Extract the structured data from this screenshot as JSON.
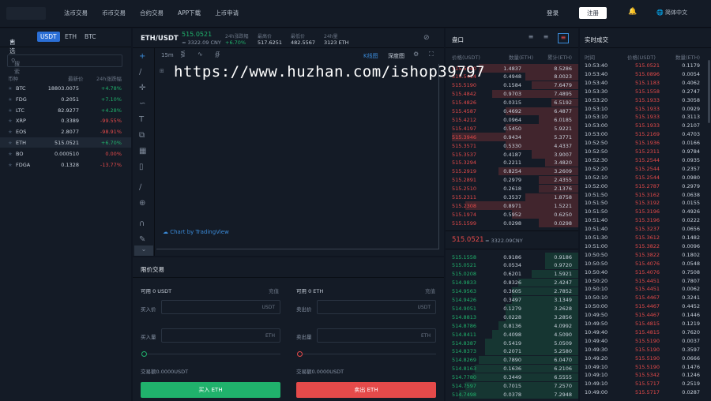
{
  "nav": {
    "items": [
      "法币交易",
      "币币交易",
      "合约交易",
      "APP下载",
      "上币申请"
    ],
    "login": "登录",
    "register": "注册",
    "language": "简体中文"
  },
  "markets": {
    "tabs": [
      "自选",
      "USDT",
      "ETH",
      "BTC"
    ],
    "search_placeholder": "搜索",
    "headers": [
      "币种",
      "最新价",
      "24h涨跌幅"
    ],
    "rows": [
      {
        "name": "BTC",
        "price": "18803.0075",
        "change": "+4.78%",
        "dir": "up"
      },
      {
        "name": "FDG",
        "price": "0.2051",
        "change": "+7.10%",
        "dir": "up"
      },
      {
        "name": "LTC",
        "price": "82.9277",
        "change": "+4.28%",
        "dir": "up"
      },
      {
        "name": "XRP",
        "price": "0.3389",
        "change": "-99.55%",
        "dir": "down"
      },
      {
        "name": "EOS",
        "price": "2.8077",
        "change": "-98.91%",
        "dir": "down"
      },
      {
        "name": "ETH",
        "price": "515.0521",
        "change": "+6.70%",
        "dir": "up",
        "selected": true
      },
      {
        "name": "BO",
        "price": "0.000510",
        "change": "0.00%",
        "dir": "down"
      },
      {
        "name": "FDGA",
        "price": "0.1328",
        "change": "-13.77%",
        "dir": "down"
      }
    ]
  },
  "ticker": {
    "pair": "ETH/USDT",
    "price": "515.0521",
    "cny": "≈ 3322.09 CNY",
    "change_label": "24h涨跌幅",
    "change": "+6.70%",
    "high_label": "最高价",
    "high": "517.6251",
    "low_label": "最低价",
    "low": "482.5567",
    "vol_label": "24h量",
    "vol": "3123 ETH"
  },
  "chart": {
    "interval": "15m",
    "kline": "K线图",
    "depth": "深度图",
    "brand": "Chart by TradingView"
  },
  "trade": {
    "title": "限价交易",
    "buy": {
      "avail": "可用 0 USDT",
      "recharge": "充值",
      "price_label": "买入价",
      "price_unit": "USDT",
      "amount_label": "买入量",
      "amount_unit": "ETH",
      "total": "交易额0.0000USDT",
      "button": "买入 ETH"
    },
    "sell": {
      "avail": "可用 0 ETH",
      "recharge": "充值",
      "price_label": "卖出价",
      "price_unit": "USDT",
      "amount_label": "卖出量",
      "amount_unit": "ETH",
      "total": "交易额0.0000USDT",
      "button": "卖出 ETH"
    }
  },
  "orderbook": {
    "title": "盘口",
    "headers": [
      "价格(USDT)",
      "数量(ETH)",
      "累计(ETH)"
    ],
    "asks": [
      [
        "515.5940",
        "1.4837",
        "8.5286",
        0.75
      ],
      [
        "515.5414",
        "0.4948",
        "8.0023",
        0.4
      ],
      [
        "515.5190",
        "0.1584",
        "7.6479",
        0.35
      ],
      [
        "515.4842",
        "0.9703",
        "7.4895",
        0.65
      ],
      [
        "515.4826",
        "0.0315",
        "6.5192",
        0.2
      ],
      [
        "515.4587",
        "0.4692",
        "6.4877",
        0.55
      ],
      [
        "515.4212",
        "0.0964",
        "6.0185",
        0.3
      ],
      [
        "515.4197",
        "0.5450",
        "5.9221",
        0.55
      ],
      [
        "515.3946",
        "0.9434",
        "5.3771",
        0.95
      ],
      [
        "515.3571",
        "0.5330",
        "4.4337",
        0.55
      ],
      [
        "515.3537",
        "0.4187",
        "3.9007",
        0.35
      ],
      [
        "515.3294",
        "0.2211",
        "3.4820",
        0.25
      ],
      [
        "515.2919",
        "0.8254",
        "3.2609",
        0.6
      ],
      [
        "515.2891",
        "0.2979",
        "2.4355",
        0.3
      ],
      [
        "515.2510",
        "0.2618",
        "2.1376",
        0.3
      ],
      [
        "515.2311",
        "0.3537",
        "1.8758",
        0.4
      ],
      [
        "515.2308",
        "0.8971",
        "1.5221",
        0.85
      ],
      [
        "515.1974",
        "0.5952",
        "0.6250",
        0.5
      ],
      [
        "515.1599",
        "0.0298",
        "0.0298",
        0.3
      ]
    ],
    "last": "515.0521",
    "last_cny": "≈ 3322.09CNY",
    "bids": [
      [
        "515.1558",
        "0.9186",
        "0.9186",
        0.25
      ],
      [
        "515.0521",
        "0.0534",
        "0.9720",
        0.25
      ],
      [
        "515.0208",
        "0.6201",
        "1.5921",
        0.35
      ],
      [
        "514.9833",
        "0.8326",
        "2.4247",
        0.45
      ],
      [
        "514.9563",
        "0.3605",
        "2.7852",
        0.5
      ],
      [
        "514.9426",
        "0.3497",
        "3.1349",
        0.5
      ],
      [
        "514.9051",
        "0.1279",
        "3.2628",
        0.55
      ],
      [
        "514.8813",
        "0.0228",
        "3.2856",
        0.55
      ],
      [
        "514.8786",
        "0.8136",
        "4.0992",
        0.6
      ],
      [
        "514.8411",
        "0.4098",
        "4.5090",
        0.65
      ],
      [
        "514.8387",
        "0.5419",
        "5.0509",
        0.7
      ],
      [
        "514.8373",
        "0.2071",
        "5.2580",
        0.7
      ],
      [
        "514.8269",
        "0.7890",
        "6.0470",
        0.75
      ],
      [
        "514.8163",
        "0.1636",
        "6.2106",
        0.78
      ],
      [
        "514.7780",
        "0.3449",
        "6.5555",
        0.8
      ],
      [
        "514.7597",
        "0.7015",
        "7.2570",
        0.85
      ],
      [
        "514.7498",
        "0.0378",
        "7.2948",
        0.9
      ]
    ]
  },
  "trades": {
    "title": "实时成交",
    "headers": [
      "时间",
      "价格(USDT)",
      "数量(ETH)"
    ],
    "rows": [
      [
        "10:53:40",
        "515.0521",
        "0.1179"
      ],
      [
        "10:53:40",
        "515.0896",
        "0.0054"
      ],
      [
        "10:53:40",
        "515.1183",
        "0.4062"
      ],
      [
        "10:53:30",
        "515.1558",
        "0.2747"
      ],
      [
        "10:53:20",
        "515.1933",
        "0.3058"
      ],
      [
        "10:53:10",
        "515.1933",
        "0.0929"
      ],
      [
        "10:53:10",
        "515.1933",
        "0.3113"
      ],
      [
        "10:53:00",
        "515.1933",
        "0.2107"
      ],
      [
        "10:53:00",
        "515.2169",
        "0.4703"
      ],
      [
        "10:52:50",
        "515.1936",
        "0.0166"
      ],
      [
        "10:52:50",
        "515.2311",
        "0.9784"
      ],
      [
        "10:52:30",
        "515.2544",
        "0.0935"
      ],
      [
        "10:52:20",
        "515.2544",
        "0.2357"
      ],
      [
        "10:52:10",
        "515.2544",
        "0.0980"
      ],
      [
        "10:52:00",
        "515.2787",
        "0.2979"
      ],
      [
        "10:51:50",
        "515.3162",
        "0.0638"
      ],
      [
        "10:51:50",
        "515.3192",
        "0.0155"
      ],
      [
        "10:51:50",
        "515.3196",
        "0.4926"
      ],
      [
        "10:51:40",
        "515.3196",
        "0.0222"
      ],
      [
        "10:51:40",
        "515.3237",
        "0.0656"
      ],
      [
        "10:51:30",
        "515.3612",
        "0.1482"
      ],
      [
        "10:51:00",
        "515.3822",
        "0.0096"
      ],
      [
        "10:50:50",
        "515.3822",
        "0.1802"
      ],
      [
        "10:50:50",
        "515.4076",
        "0.0548"
      ],
      [
        "10:50:40",
        "515.4076",
        "0.7508"
      ],
      [
        "10:50:20",
        "515.4451",
        "0.7807"
      ],
      [
        "10:50:10",
        "515.4451",
        "0.0062"
      ],
      [
        "10:50:10",
        "515.4467",
        "0.3241"
      ],
      [
        "10:50:00",
        "515.4467",
        "0.4452"
      ],
      [
        "10:49:50",
        "515.4467",
        "0.1446"
      ],
      [
        "10:49:50",
        "515.4815",
        "0.1219"
      ],
      [
        "10:49:40",
        "515.4815",
        "0.7620"
      ],
      [
        "10:49:40",
        "515.5190",
        "0.0037"
      ],
      [
        "10:49:30",
        "515.5190",
        "0.3597"
      ],
      [
        "10:49:20",
        "515.5190",
        "0.0666"
      ],
      [
        "10:49:10",
        "515.5190",
        "0.1476"
      ],
      [
        "10:49:10",
        "515.5342",
        "0.1246"
      ],
      [
        "10:49:10",
        "515.5717",
        "0.2519"
      ],
      [
        "10:49:00",
        "515.5717",
        "0.0287"
      ]
    ]
  },
  "watermark": "https://www.huzhan.com/ishop39797",
  "colors": {
    "up": "#20b26c",
    "down": "#e54a4a",
    "accent": "#2b6fd6"
  }
}
